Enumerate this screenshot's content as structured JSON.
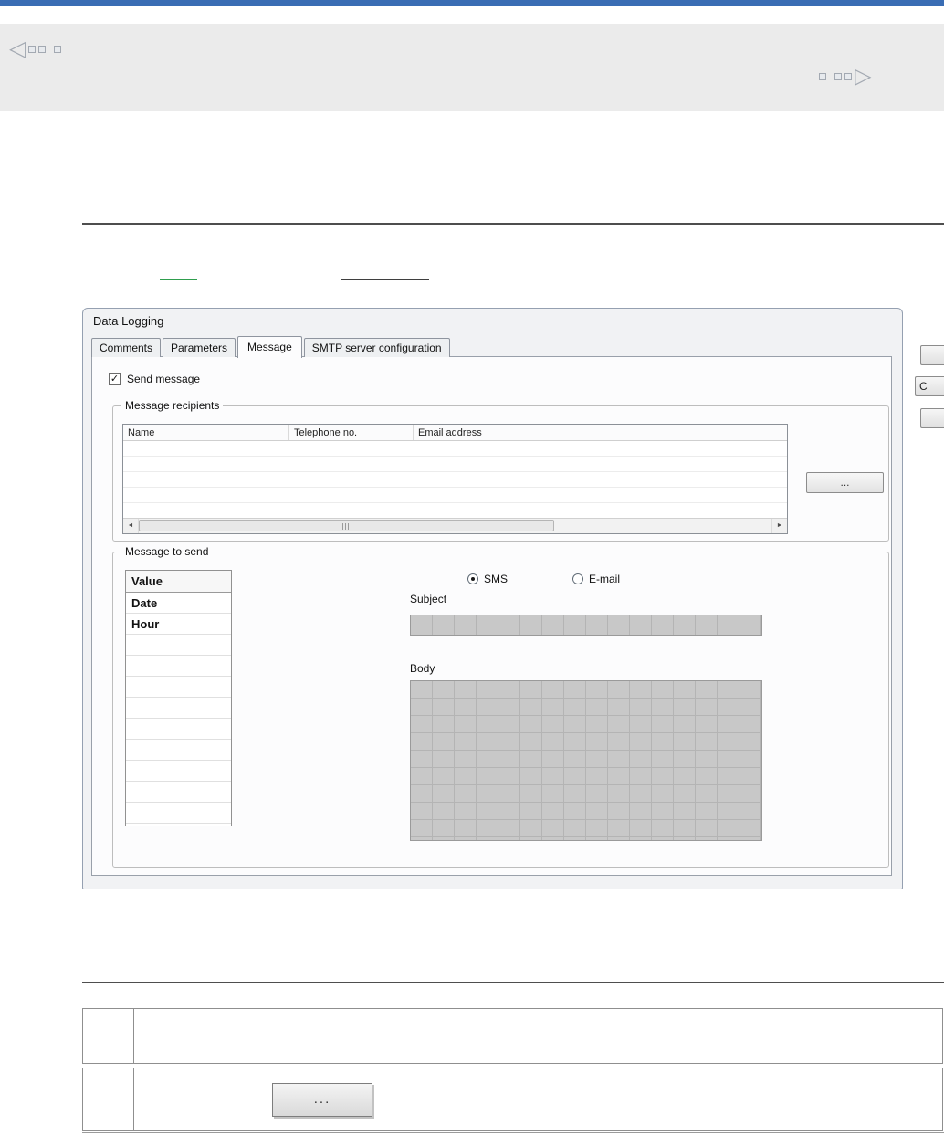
{
  "icons": {
    "nav_prev_arrow": "◁",
    "nav_next_arrow": "▷",
    "scrollbar_left_arrow": "◄",
    "scrollbar_right_arrow": "►",
    "checkbox_check": "✓"
  },
  "dialog": {
    "title": "Data Logging",
    "tabs": [
      {
        "label": "Comments"
      },
      {
        "label": "Parameters"
      },
      {
        "label": "Message"
      },
      {
        "label": "SMTP server configuration"
      }
    ],
    "active_tab": "Message",
    "send_message_label": "Send message",
    "send_message_checked": true,
    "recipients": {
      "group_label": "Message recipients",
      "columns": [
        "Name",
        "Telephone no.",
        "Email address"
      ],
      "empty_row_count": 5,
      "browse_button_label": "..."
    },
    "message_to_send": {
      "group_label": "Message to send",
      "value_table": {
        "header": "Value",
        "rows": [
          "Date",
          "Hour"
        ],
        "empty_row_count": 9
      },
      "type_options": [
        {
          "label": "SMS",
          "selected": true
        },
        {
          "label": "E-mail",
          "selected": false
        }
      ],
      "subject_label": "Subject",
      "body_label": "Body"
    },
    "partial_side_buttons": {
      "second_label": "C"
    }
  },
  "procedure_table": {
    "dots_button_label": "..."
  },
  "colors": {
    "accent_bar": "#3a6db4",
    "link_green": "#2f9e4e"
  }
}
